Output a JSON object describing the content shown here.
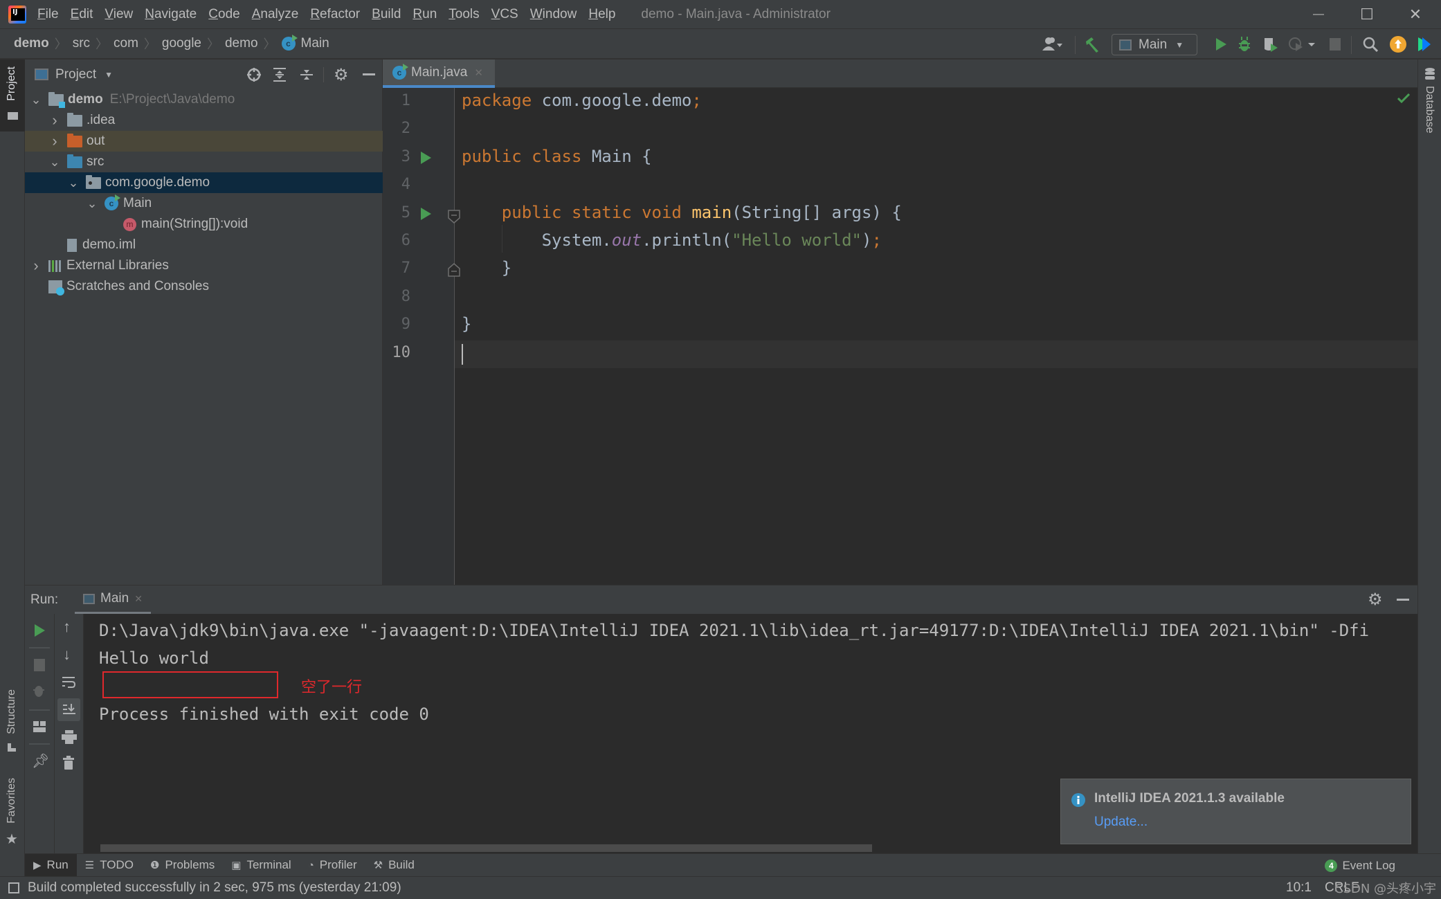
{
  "window": {
    "title": "demo - Main.java - Administrator",
    "controls": {
      "minimize": "—",
      "maximize": "☐",
      "close": "✕"
    }
  },
  "menu": [
    "File",
    "Edit",
    "View",
    "Navigate",
    "Code",
    "Analyze",
    "Refactor",
    "Build",
    "Run",
    "Tools",
    "VCS",
    "Window",
    "Help"
  ],
  "breadcrumb": [
    "demo",
    "src",
    "com",
    "google",
    "demo",
    "Main"
  ],
  "toolbar": {
    "run_config": "Main",
    "icons": [
      "account-icon",
      "build-hammer-icon",
      "run-config-icon",
      "run-icon",
      "debug-icon",
      "coverage-icon",
      "profile-icon",
      "stop-icon",
      "search-icon",
      "update-icon",
      "toolbox-icon"
    ]
  },
  "left_stripe": {
    "project": "Project",
    "structure": "Structure",
    "favorites": "Favorites"
  },
  "right_stripe": {
    "database": "Database"
  },
  "project_panel": {
    "title": "Project",
    "tree": [
      {
        "label": "demo",
        "hint": "E:\\Project\\Java\\demo",
        "depth": 0,
        "expanded": true,
        "icon": "module-folder",
        "bold": true
      },
      {
        "label": ".idea",
        "depth": 1,
        "expanded": false,
        "icon": "folder-gray"
      },
      {
        "label": "out",
        "depth": 1,
        "expanded": false,
        "icon": "folder-orange",
        "excluded": true
      },
      {
        "label": "src",
        "depth": 1,
        "expanded": true,
        "icon": "folder-blue"
      },
      {
        "label": "com.google.demo",
        "depth": 2,
        "expanded": true,
        "icon": "package",
        "selected": true
      },
      {
        "label": "Main",
        "depth": 3,
        "expanded": true,
        "icon": "class"
      },
      {
        "label": "main(String[]):void",
        "depth": 4,
        "icon": "method"
      },
      {
        "label": "demo.iml",
        "depth": 1,
        "icon": "iml-file"
      },
      {
        "label": "External Libraries",
        "depth": 0,
        "expanded": false,
        "icon": "libraries"
      },
      {
        "label": "Scratches and Consoles",
        "depth": 0,
        "icon": "scratches"
      }
    ]
  },
  "editor": {
    "tab": "Main.java",
    "line_numbers": [
      "1",
      "2",
      "3",
      "4",
      "5",
      "6",
      "7",
      "8",
      "9",
      "10"
    ],
    "lines": {
      "l1_kw": "package",
      "l1_rest": " com.google.demo",
      "l1_semi": ";",
      "l3_kw": "public class",
      "l3_rest": " Main {",
      "l5_kw": "    public static void",
      "l5_fn": " main",
      "l5_rest": "(String[] args) {",
      "l6_a": "        System.",
      "l6_field": "out",
      "l6_b": ".println(",
      "l6_str": "\"Hello world\"",
      "l6_c": ")",
      "l6_semi": ";",
      "l7": "    }",
      "l9": "}"
    },
    "cursor_position": "10:1"
  },
  "run_panel": {
    "label": "Run:",
    "tab": "Main",
    "console": [
      "D:\\Java\\jdk9\\bin\\java.exe \"-javaagent:D:\\IDEA\\IntelliJ IDEA 2021.1\\lib\\idea_rt.jar=49177:D:\\IDEA\\IntelliJ IDEA 2021.1\\bin\" -Dfi",
      "Hello world",
      "",
      "Process finished with exit code 0"
    ],
    "annotation": "空了一行"
  },
  "notification": {
    "title": "IntelliJ IDEA 2021.1.3 available",
    "link": "Update..."
  },
  "tool_tabs": [
    {
      "label": "Run",
      "icon": "▶"
    },
    {
      "label": "TODO",
      "icon": "☰"
    },
    {
      "label": "Problems",
      "icon": "❶"
    },
    {
      "label": "Terminal",
      "icon": "▣"
    },
    {
      "label": "Profiler",
      "icon": "◔"
    },
    {
      "label": "Build",
      "icon": "⚒"
    }
  ],
  "event_log": {
    "count": "4",
    "label": "Event Log"
  },
  "status": {
    "message": "Build completed successfully in 2 sec, 975 ms (yesterday 21:09)",
    "position": "10:1",
    "line_sep": "CRLF",
    "watermark": "CSDN @头疼小宇"
  }
}
